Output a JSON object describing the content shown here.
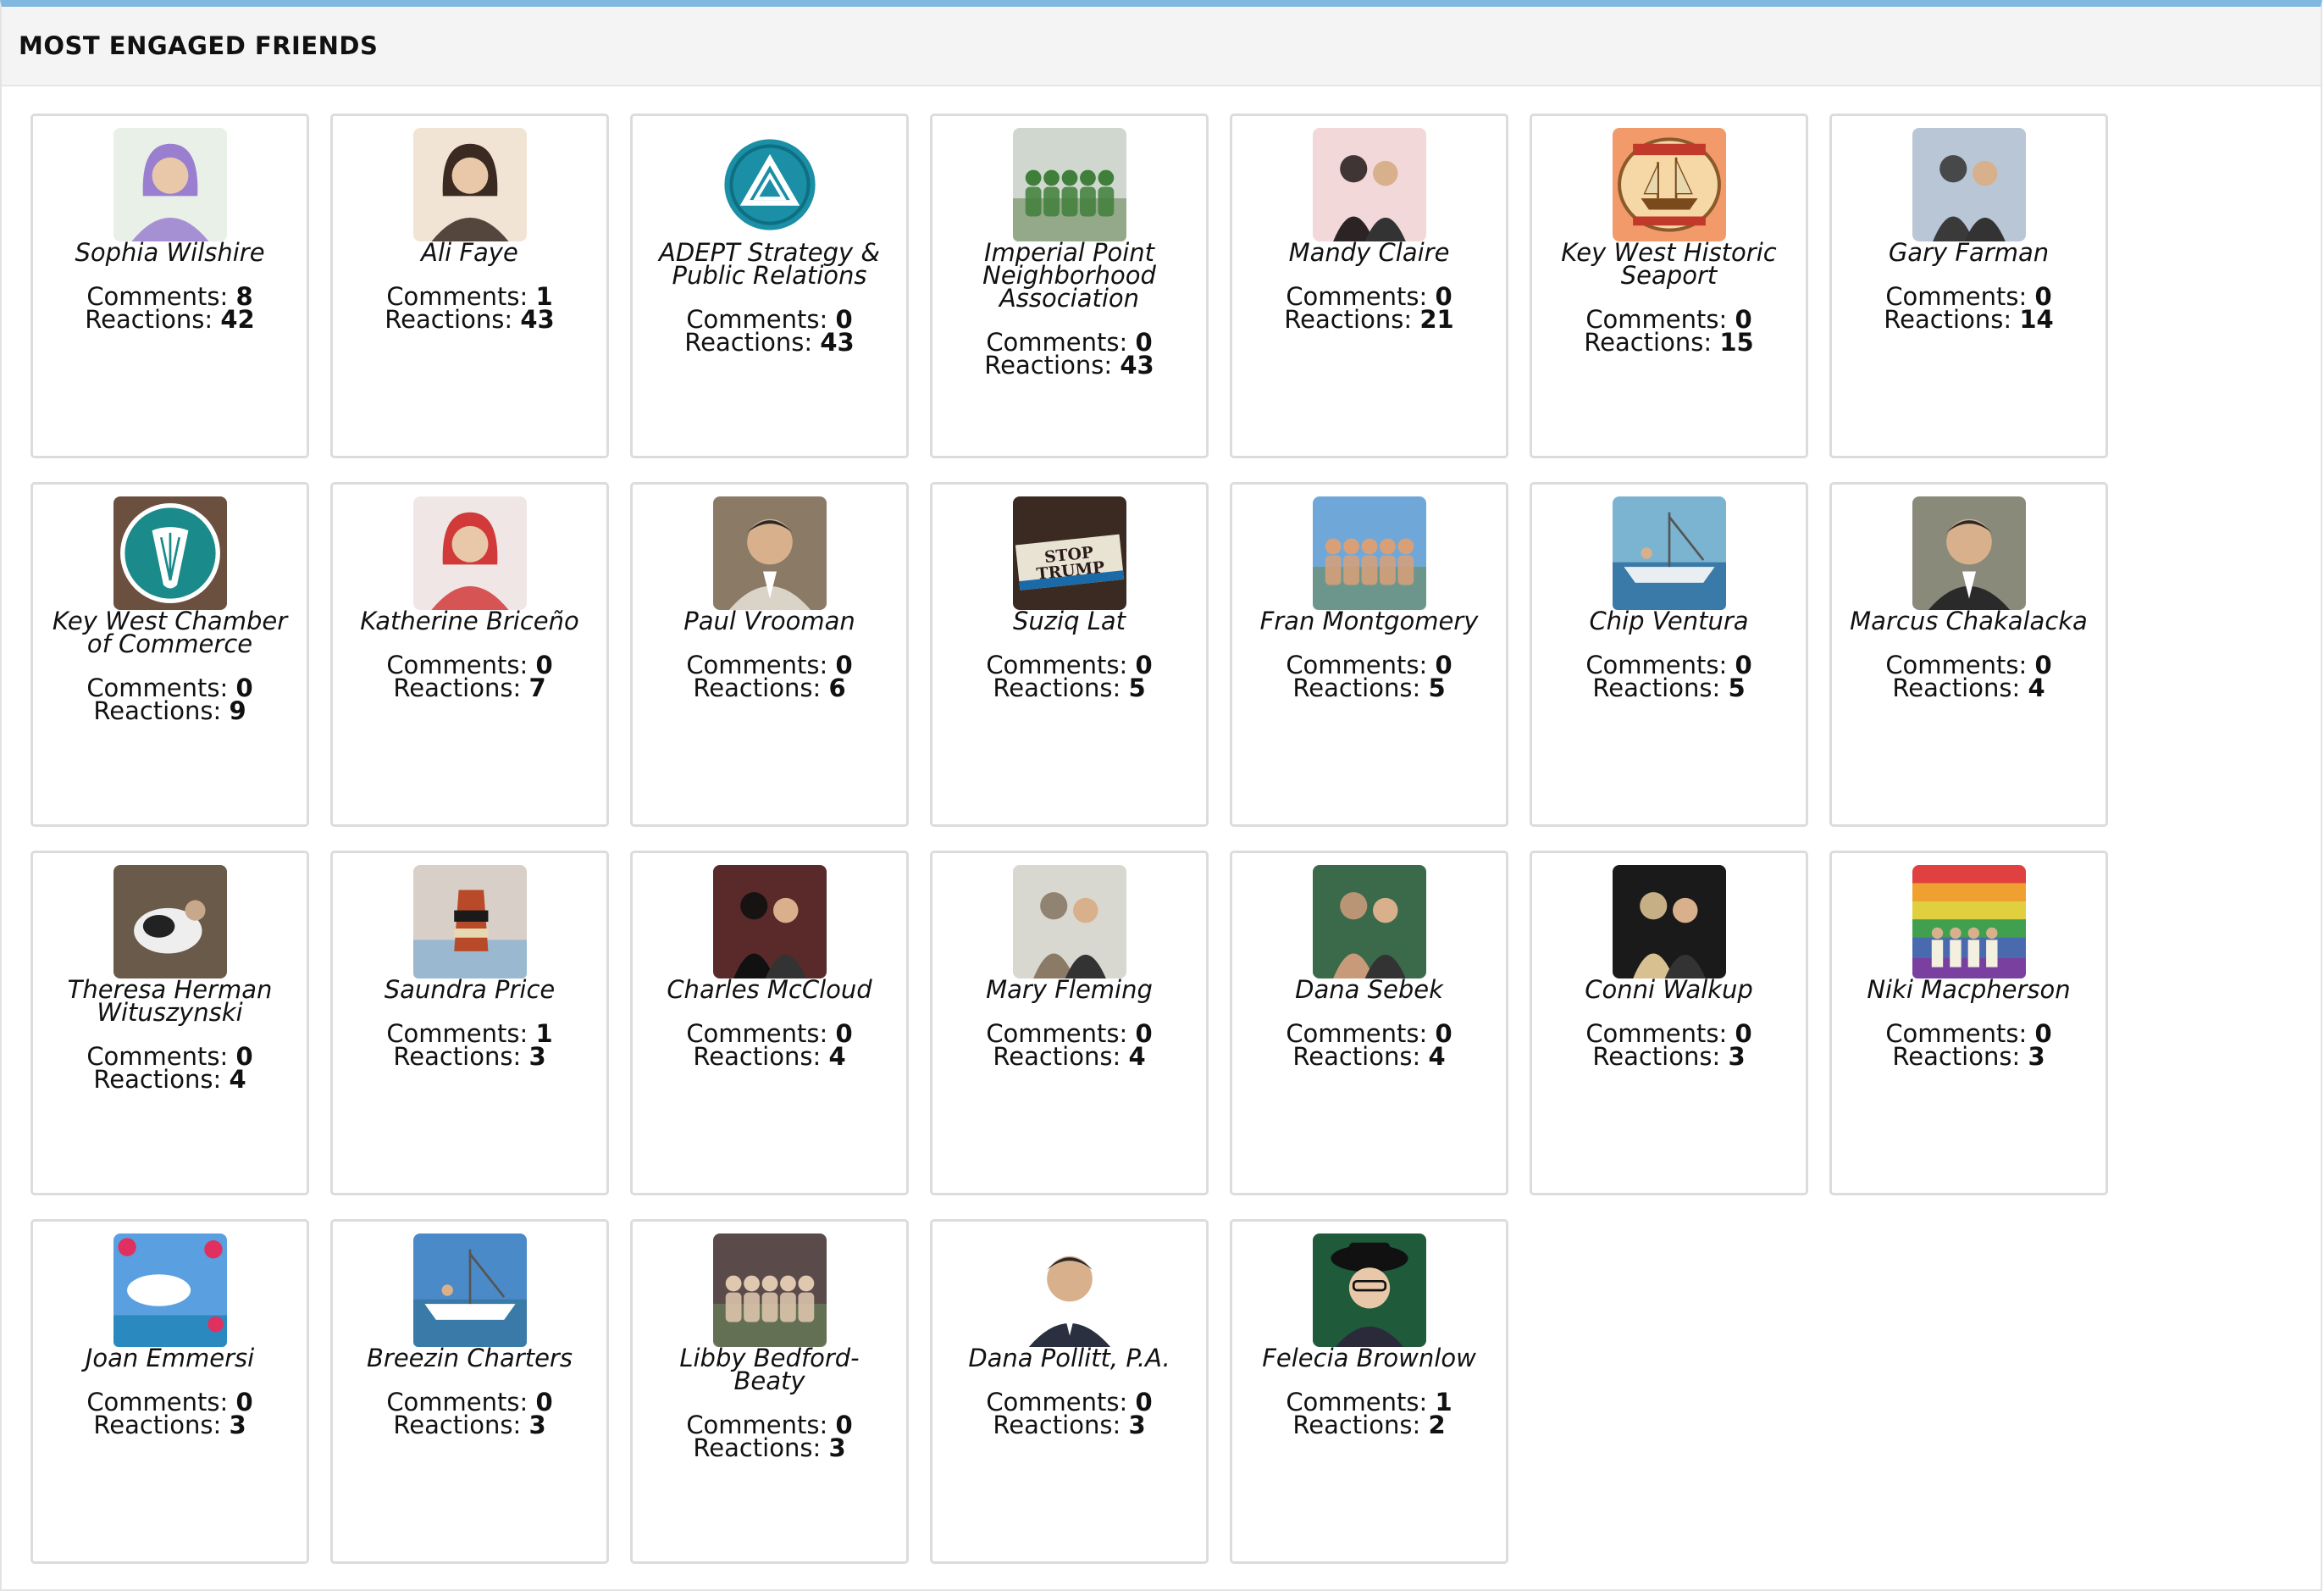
{
  "panel": {
    "title": "MOST ENGAGED FRIENDS"
  },
  "labels": {
    "comments": "Comments: ",
    "reactions": "Reactions: "
  },
  "friends": [
    {
      "name": "Sophia Wilshire",
      "comments": "8",
      "reactions": "42",
      "avatar": {
        "bg": "#e8f0e8",
        "fg": "#9a7fd0",
        "kind": "portrait-woman"
      }
    },
    {
      "name": "Ali Faye",
      "comments": "1",
      "reactions": "43",
      "avatar": {
        "bg": "#f1e4d4",
        "fg": "#3a2a22",
        "kind": "portrait-woman"
      }
    },
    {
      "name": "ADEPT Strategy & Public Relations",
      "comments": "0",
      "reactions": "43",
      "avatar": {
        "bg": "#ffffff",
        "fg": "#1a8fa6",
        "kind": "logo-triangle"
      }
    },
    {
      "name": "Imperial Point Neighborhood Association",
      "comments": "0",
      "reactions": "43",
      "avatar": {
        "bg": "#cfd7cf",
        "fg": "#3f7f3a",
        "kind": "group-photo"
      }
    },
    {
      "name": "Mandy Claire",
      "comments": "0",
      "reactions": "21",
      "avatar": {
        "bg": "#f2d8d8",
        "fg": "#2c2424",
        "kind": "couple-photo"
      }
    },
    {
      "name": "Key West Historic Seaport",
      "comments": "0",
      "reactions": "15",
      "avatar": {
        "bg": "#f39a6a",
        "fg": "#7a4a1c",
        "kind": "logo-ship"
      }
    },
    {
      "name": "Gary Farman",
      "comments": "0",
      "reactions": "14",
      "avatar": {
        "bg": "#b9c6d6",
        "fg": "#3a3a3a",
        "kind": "couple-photo"
      }
    },
    {
      "name": "Key West Chamber of Commerce",
      "comments": "0",
      "reactions": "9",
      "avatar": {
        "bg": "#6b4f3f",
        "fg": "#1b8a8a",
        "kind": "logo-shell"
      }
    },
    {
      "name": "Katherine Briceño",
      "comments": "0",
      "reactions": "7",
      "avatar": {
        "bg": "#f0e6e6",
        "fg": "#d23a3a",
        "kind": "portrait-woman"
      }
    },
    {
      "name": "Paul Vrooman",
      "comments": "0",
      "reactions": "6",
      "avatar": {
        "bg": "#8a7a66",
        "fg": "#d9d3c8",
        "kind": "portrait-man"
      }
    },
    {
      "name": "Suziq Lat",
      "comments": "0",
      "reactions": "5",
      "avatar": {
        "bg": "#3a2a22",
        "fg": "#e9e3d3",
        "kind": "sign-stop"
      }
    },
    {
      "name": "Fran Montgomery",
      "comments": "0",
      "reactions": "5",
      "avatar": {
        "bg": "#6fa8d8",
        "fg": "#d9a078",
        "kind": "group-photo"
      }
    },
    {
      "name": "Chip Ventura",
      "comments": "0",
      "reactions": "5",
      "avatar": {
        "bg": "#7bb4d0",
        "fg": "#e8eef2",
        "kind": "boat-photo"
      }
    },
    {
      "name": "Marcus Chakalacka",
      "comments": "0",
      "reactions": "4",
      "avatar": {
        "bg": "#8a8a7a",
        "fg": "#2a2a2a",
        "kind": "portrait-man"
      }
    },
    {
      "name": "Theresa Herman Wituszynski",
      "comments": "0",
      "reactions": "4",
      "avatar": {
        "bg": "#6a5a4a",
        "fg": "#222",
        "kind": "dog-photo"
      }
    },
    {
      "name": "Saundra Price",
      "comments": "1",
      "reactions": "3",
      "avatar": {
        "bg": "#d8d0c8",
        "fg": "#b84a2a",
        "kind": "buoy-photo"
      }
    },
    {
      "name": "Charles McCloud",
      "comments": "0",
      "reactions": "4",
      "avatar": {
        "bg": "#5a2a2a",
        "fg": "#111",
        "kind": "couple-photo"
      }
    },
    {
      "name": "Mary Fleming",
      "comments": "0",
      "reactions": "4",
      "avatar": {
        "bg": "#d8d8d0",
        "fg": "#8a7a66",
        "kind": "couple-photo"
      }
    },
    {
      "name": "Dana Sebek",
      "comments": "0",
      "reactions": "4",
      "avatar": {
        "bg": "#3a6a4a",
        "fg": "#c89a7a",
        "kind": "couple-photo"
      }
    },
    {
      "name": "Conni Walkup",
      "comments": "0",
      "reactions": "3",
      "avatar": {
        "bg": "#1a1a1a",
        "fg": "#d9c090",
        "kind": "couple-photo"
      }
    },
    {
      "name": "Niki Macpherson",
      "comments": "0",
      "reactions": "3",
      "avatar": {
        "bg": "#4a6ab0",
        "fg": "#e0c040",
        "kind": "rainbow-photo"
      }
    },
    {
      "name": "Joan Emmersi",
      "comments": "0",
      "reactions": "3",
      "avatar": {
        "bg": "#5aa0e0",
        "fg": "#e03060",
        "kind": "sky-photo"
      }
    },
    {
      "name": "Breezin Charters",
      "comments": "0",
      "reactions": "3",
      "avatar": {
        "bg": "#4a8ac8",
        "fg": "#ffffff",
        "kind": "boat-photo"
      }
    },
    {
      "name": "Libby Bedford-Beaty",
      "comments": "0",
      "reactions": "3",
      "avatar": {
        "bg": "#5a4a4a",
        "fg": "#e0c8b0",
        "kind": "group-photo"
      }
    },
    {
      "name": "Dana Pollitt, P.A.",
      "comments": "0",
      "reactions": "3",
      "avatar": {
        "bg": "#ffffff",
        "fg": "#2a3040",
        "kind": "portrait-man"
      }
    },
    {
      "name": "Felecia Brownlow",
      "comments": "1",
      "reactions": "2",
      "avatar": {
        "bg": "#1f5a3a",
        "fg": "#111",
        "kind": "portrait-hat"
      }
    }
  ]
}
